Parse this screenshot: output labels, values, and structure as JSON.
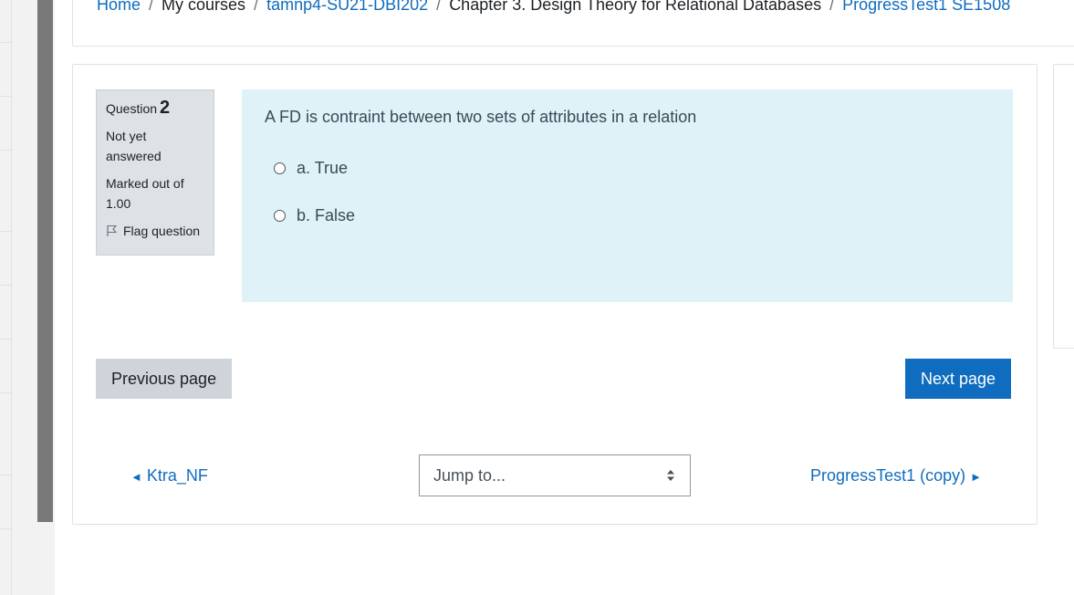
{
  "breadcrumb": {
    "items": [
      "Home",
      "My courses",
      "tamnp4-SU21-DBI202",
      "Chapter 3. Design Theory for Relational Databases",
      "ProgressTest1 SE1508"
    ],
    "separator": "/"
  },
  "question_info": {
    "question_label": "Question",
    "question_number": "2",
    "state_line1": "Not yet",
    "state_line2": "answered",
    "grade_line1": "Marked out of",
    "grade_line2": "1.00",
    "flag_label": "Flag question",
    "flag_icon": "flag-outline-icon"
  },
  "question": {
    "text": "A FD is contraint between two sets of attributes in a relation",
    "answers": [
      "a. True",
      "b. False"
    ]
  },
  "navigation": {
    "prev_label": "Previous page",
    "next_label": "Next page"
  },
  "activity_nav": {
    "prev_link": "Ktra_NF",
    "next_link": "ProgressTest1 (copy)",
    "prev_arrow": "◄",
    "next_arrow": "►",
    "jump_placeholder": "Jump to..."
  },
  "colors": {
    "link": "#0f6cbf",
    "primary_button": "#0f6cbf",
    "secondary_button": "#ced4da",
    "question_bg": "#def2f8",
    "info_bg": "#dee2e6"
  }
}
